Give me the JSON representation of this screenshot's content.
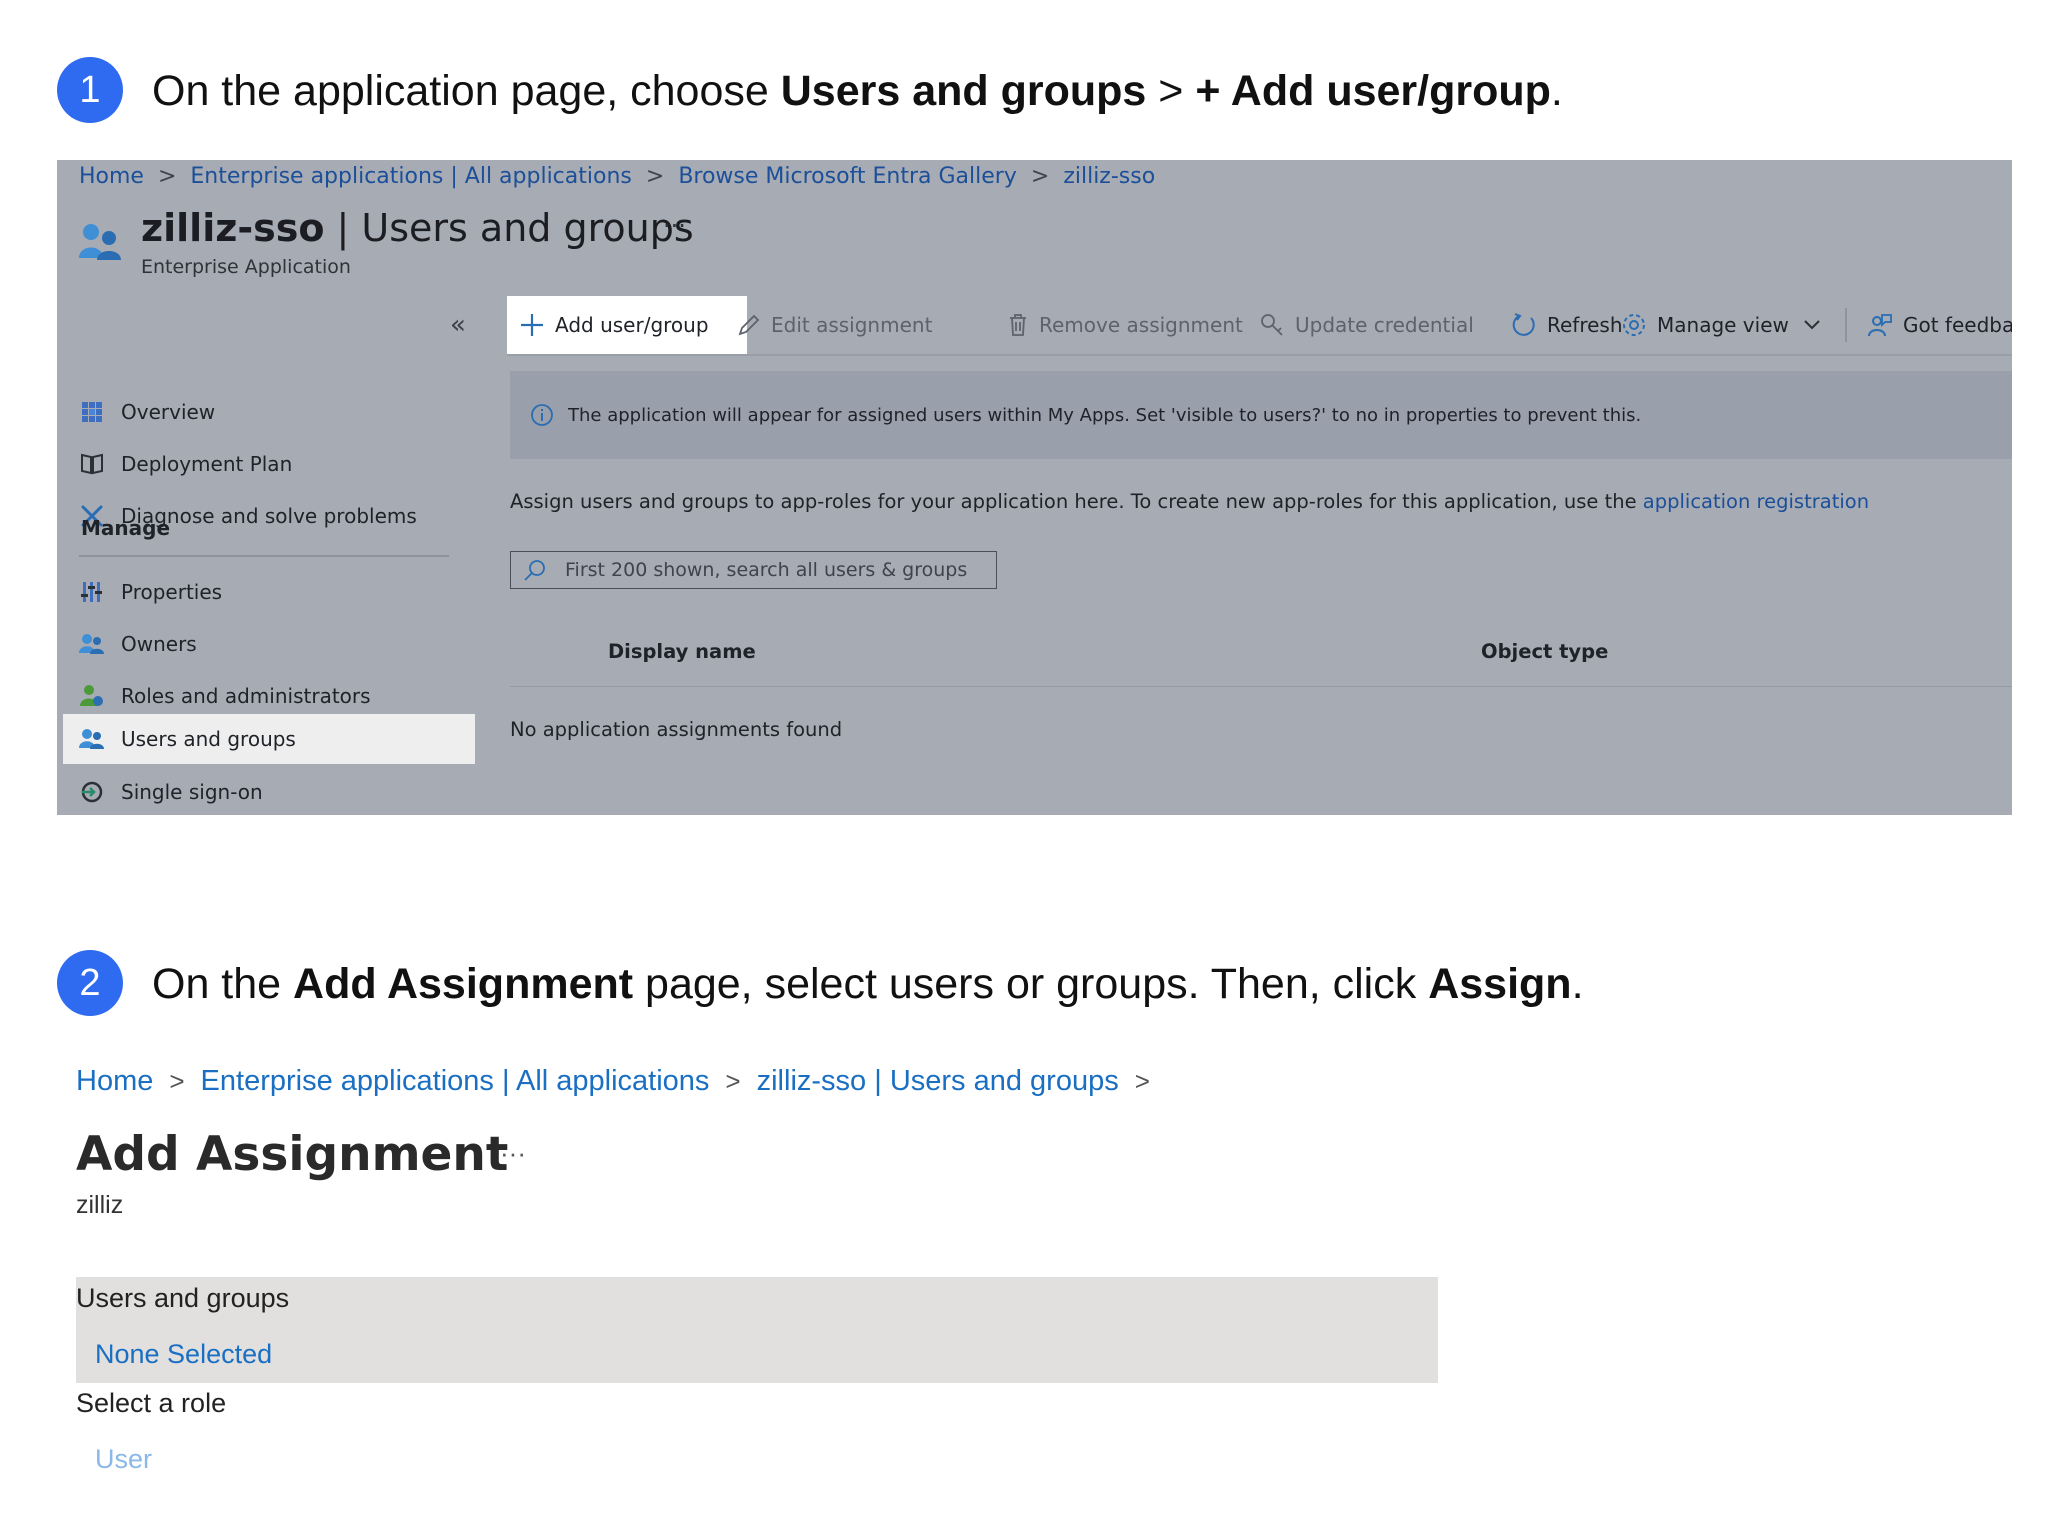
{
  "step1": {
    "number": "1",
    "text_a": "On the application page, choose ",
    "bold_a": "Users and groups",
    "text_b": " > ",
    "bold_b": "+ Add user/group",
    "text_c": "."
  },
  "panel1": {
    "breadcrumb": [
      "Home",
      "Enterprise applications | All applications",
      "Browse Microsoft Entra Gallery",
      "zilliz-sso"
    ],
    "title_bold": "zilliz-sso",
    "title_rest": " | Users and groups",
    "more": "···",
    "subtitle": "Enterprise Application",
    "collapse": "«",
    "nav": {
      "overview": "Overview",
      "deployment_plan": "Deployment Plan",
      "diagnose": "Diagnose and solve problems",
      "manage_heading": "Manage",
      "properties": "Properties",
      "owners": "Owners",
      "roles": "Roles and administrators",
      "users_groups": "Users and groups",
      "sso": "Single sign-on"
    },
    "toolbar": {
      "add": "Add user/group",
      "edit": "Edit assignment",
      "remove": "Remove assignment",
      "update": "Update credential",
      "refresh": "Refresh",
      "manage_view": "Manage view",
      "feedback": "Got feedback?"
    },
    "info": "The application will appear for assigned users within My Apps. Set 'visible to users?' to no in properties to prevent this.",
    "assign_text": "Assign users and groups to app-roles for your application here. To create new app-roles for this application, use the ",
    "assign_link": "application registration",
    "search_placeholder": "First 200 shown, search all users & groups",
    "columns": [
      "Display name",
      "Object type"
    ],
    "empty": "No application assignments found"
  },
  "step2": {
    "number": "2",
    "text_a": "On the ",
    "bold_a": "Add Assignment",
    "text_b": " page, select users or groups. Then, click ",
    "bold_b": "Assign",
    "text_c": "."
  },
  "panel2": {
    "breadcrumb": [
      "Home",
      "Enterprise applications | All applications",
      "zilliz-sso | Users and groups"
    ],
    "title": "Add Assignment",
    "more": "···",
    "subtitle": "zilliz",
    "users_groups_label": "Users and groups",
    "users_groups_value": "None Selected",
    "role_label": "Select a role",
    "role_value": "User"
  },
  "colors": {
    "step_badge": "#2f6bf0",
    "panel_bg": "#a7abb3",
    "link": "#1a6fc2"
  }
}
